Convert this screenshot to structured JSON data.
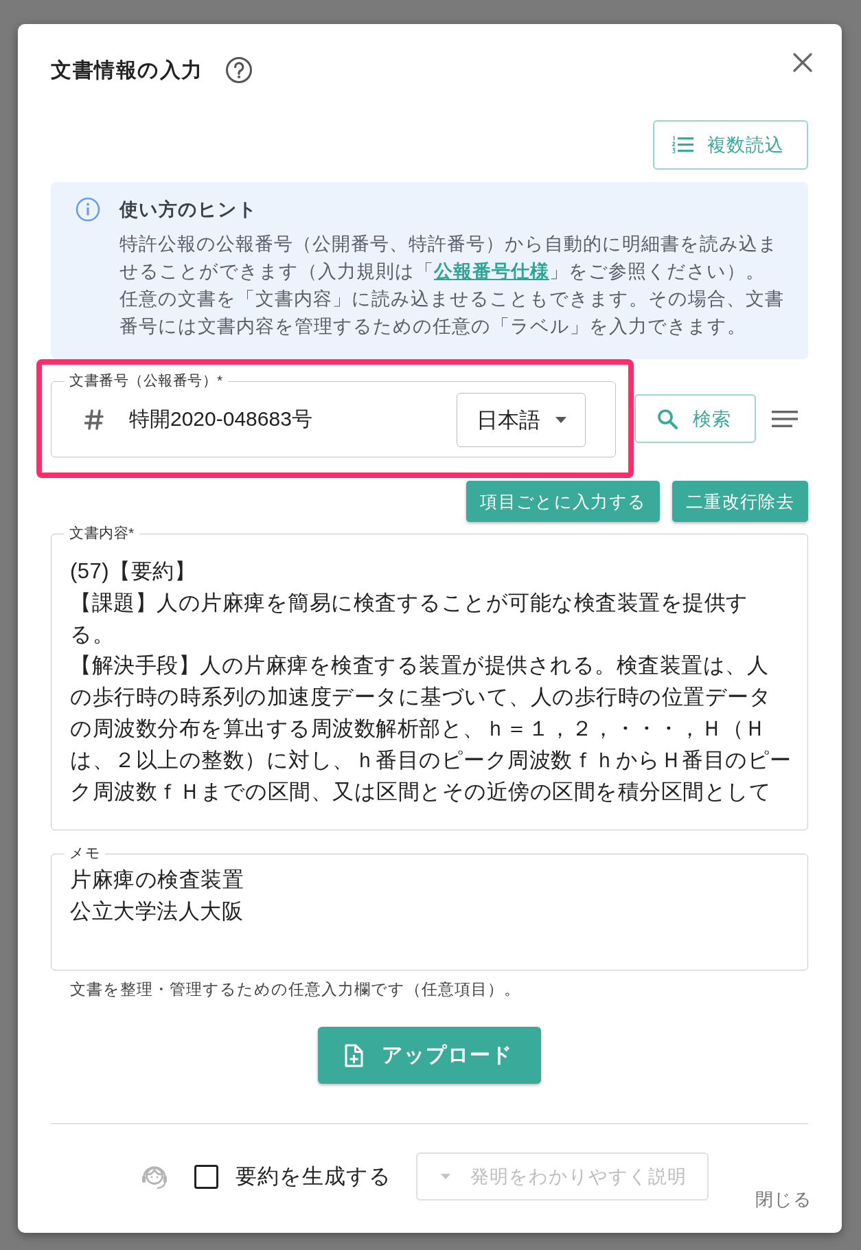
{
  "dialog": {
    "title": "文書情報の入力"
  },
  "toolbar": {
    "bulk_load_button": "複数読込"
  },
  "hint": {
    "title": "使い方のヒント",
    "paragraphs": [
      {
        "parts": [
          {
            "kind": "text",
            "text": "特許公報の公報番号（公開番号、特許番号）から自動的に明細書を読み込ませることができます（入力規則は「"
          },
          {
            "kind": "link",
            "text": "公報番号仕様"
          },
          {
            "kind": "text",
            "text": "」をご参照ください）。"
          }
        ]
      },
      {
        "parts": [
          {
            "kind": "text",
            "text": "任意の文書を「文書内容」に読み込ませることもできます。 その場合、文書番号には文書内容を管理するための任意の「ラベル」を入力できます。"
          }
        ]
      }
    ]
  },
  "document_number": {
    "label": "文書番号（公報番号）*",
    "value": "特開2020-048683号",
    "language": "日本語",
    "highlighted": true
  },
  "search_button": "検索",
  "action_buttons": [
    "項目ごとに入力する",
    "二重改行除去"
  ],
  "content": {
    "label": "文書内容*",
    "lines": [
      "(57)【要約】",
      "【課題】人の片麻痺を簡易に検査することが可能な検査装置を提供す",
      "る。",
      "【解決手段】人の片麻痺を検査する装置が提供される。検査装置は、人",
      "の歩行時の時系列の加速度データに基づいて、人の歩行時の位置データ",
      "の周波数分布を算出する周波数解析部と、ｈ＝１，２，・・・，Ｈ（Ｈ",
      "は、２以上の整数）に対し、ｈ番目のピーク周波数ｆｈからＨ番目のピー",
      "ク周波数ｆＨまでの区間、又は区間とその近傍の区間を積分区間として"
    ]
  },
  "memo": {
    "label": "メモ",
    "lines": [
      "片麻痺の検査装置",
      "公立大学法人大阪"
    ],
    "helper": "文書を整理・管理するための任意入力欄です（任意項目）。"
  },
  "upload_button": "アップロード",
  "footer": {
    "summary_checkbox": {
      "label": "要約を生成する",
      "checked": false
    },
    "style_select": {
      "value": "発明をわかりやすく説明",
      "disabled": true
    },
    "close_button": "閉じる"
  }
}
